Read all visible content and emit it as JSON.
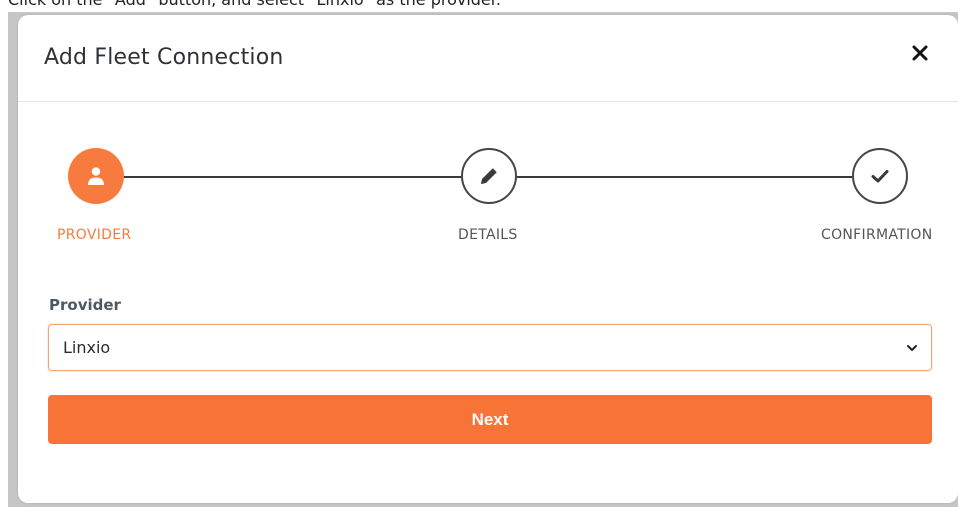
{
  "instruction": "Click on the \"Add\" button, and select \"Linxio\" as the provider.",
  "modal": {
    "title": "Add Fleet Connection",
    "close_icon": "close-icon"
  },
  "stepper": {
    "active_color": "#f77b3e",
    "steps": [
      {
        "label": "PROVIDER",
        "icon": "user-icon",
        "state": "active"
      },
      {
        "label": "DETAILS",
        "icon": "pencil-icon",
        "state": "inactive"
      },
      {
        "label": "CONFIRMATION",
        "icon": "check-icon",
        "state": "inactive"
      }
    ]
  },
  "form": {
    "provider_label": "Provider",
    "provider_value": "Linxio",
    "chevron_icon": "chevron-down-icon"
  },
  "actions": {
    "next_label": "Next",
    "next_color": "#f77336"
  }
}
